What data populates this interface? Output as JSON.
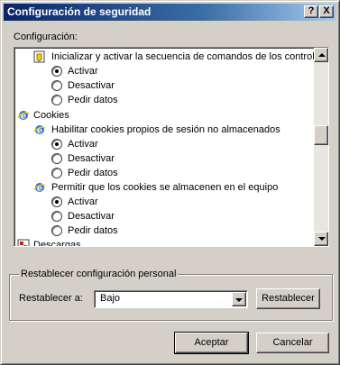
{
  "window": {
    "title": "Configuración de seguridad",
    "help_glyph": "?",
    "close_glyph": "X"
  },
  "settings_label": "Configuración:",
  "settings_list": {
    "items": [
      {
        "kind": "setting",
        "icon": "script-setting-icon",
        "label": "Inicializar y activar la secuencia de comandos de los controles"
      },
      {
        "kind": "option",
        "label": "Activar",
        "checked": true
      },
      {
        "kind": "option",
        "label": "Desactivar",
        "checked": false
      },
      {
        "kind": "option",
        "label": "Pedir datos",
        "checked": false
      },
      {
        "kind": "category",
        "icon": "ie-globe-icon",
        "label": "Cookies"
      },
      {
        "kind": "setting",
        "icon": "ie-globe-icon",
        "label": "Habilitar cookies propios de sesión no almacenados"
      },
      {
        "kind": "option",
        "label": "Activar",
        "checked": true
      },
      {
        "kind": "option",
        "label": "Desactivar",
        "checked": false
      },
      {
        "kind": "option",
        "label": "Pedir datos",
        "checked": false
      },
      {
        "kind": "setting",
        "icon": "ie-globe-icon",
        "label": "Permitir que los cookies se almacenen en el equipo"
      },
      {
        "kind": "option",
        "label": "Activar",
        "checked": true
      },
      {
        "kind": "option",
        "label": "Desactivar",
        "checked": false
      },
      {
        "kind": "option",
        "label": "Pedir datos",
        "checked": false
      },
      {
        "kind": "category",
        "icon": "download-icon",
        "label": "Descargas"
      }
    ]
  },
  "reset_group": {
    "title": "Restablecer configuración personal",
    "label": "Restablecer a:",
    "selected_level": "Bajo",
    "reset_button": "Restablecer"
  },
  "buttons": {
    "accept": "Aceptar",
    "cancel": "Cancelar"
  },
  "colors": {
    "title_bar_start": "#0a246a",
    "title_bar_end": "#a6caf0",
    "dialog_face": "#d4d0c8"
  }
}
